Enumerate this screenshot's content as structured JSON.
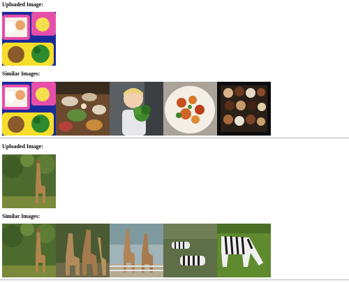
{
  "groups": [
    {
      "uploaded_label": "Uploaded Image:",
      "similar_label": "Similar Images:",
      "uploaded_image": "bento-lunchbox-image",
      "similar_images": [
        "bento-lunchbox-image",
        "buffet-table-image",
        "child-with-broccoli-image",
        "meat-plate-image",
        "donut-box-image"
      ]
    },
    {
      "uploaded_label": "Uploaded Image:",
      "similar_label": "Similar Images:",
      "uploaded_image": "giraffe-trees-image",
      "similar_images": [
        "giraffe-trees-image",
        "giraffes-group-image",
        "giraffes-zoo-image",
        "zebras-field-image",
        "zebra-grazing-image"
      ]
    }
  ]
}
